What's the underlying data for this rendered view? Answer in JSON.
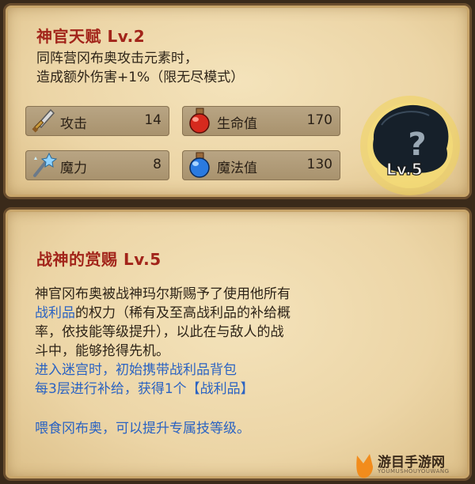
{
  "talent": {
    "title": "神官天赋 Lv.2",
    "desc_line1": "同阵营冈布奥攻击元素时，",
    "desc_line2": "造成额外伤害+1%（限无尽模式）"
  },
  "stats": {
    "attack": {
      "label": "攻击",
      "value": "14"
    },
    "magic": {
      "label": "魔力",
      "value": "8"
    },
    "hp": {
      "label": "生命值",
      "value": "170"
    },
    "mp": {
      "label": "魔法值",
      "value": "130"
    }
  },
  "badge": {
    "level": "Lv.5",
    "icon": "question-mark"
  },
  "reward": {
    "title": "战神的赏赐 Lv.5",
    "line1": "神官冈布奥被战神玛尔斯赐予了使用他所有",
    "line2_link": "战利品",
    "line2_rest": "的权力（稀有及至高战利品的补给概",
    "line3": "率，依技能等级提升），以此在与敌人的战",
    "line4": "斗中，能够抢得先机。",
    "blue1": "进入迷宫时，初始携带战利品背包",
    "blue2": "每3层进行补给，获得1个【战利品】",
    "blue3": "喂食冈布奥，可以提升专属技等级。"
  },
  "watermark": {
    "text": "游目手游网",
    "sub": "YOUMUSHOUYOUWANG"
  },
  "colors": {
    "title": "#a2241a",
    "link": "#2b63c2",
    "text": "#2e2418"
  }
}
